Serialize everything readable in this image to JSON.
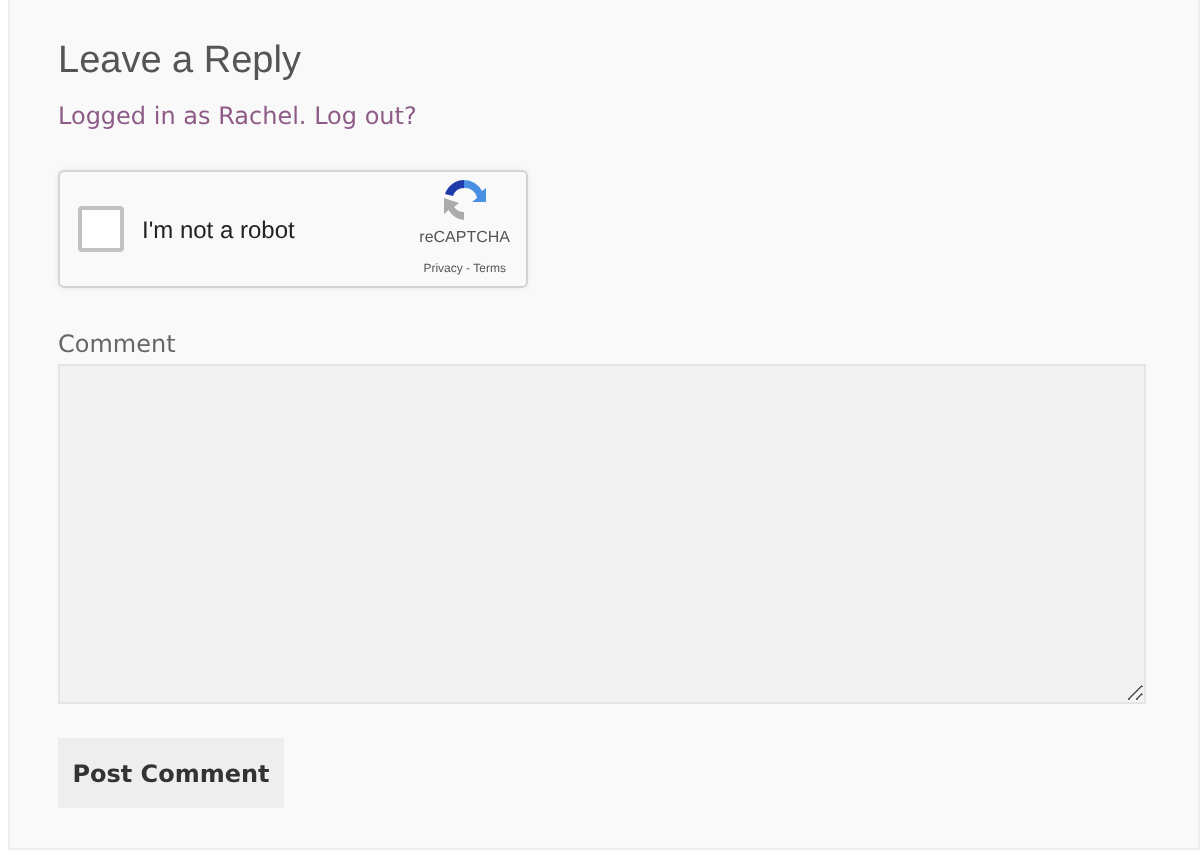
{
  "title": "Leave a Reply",
  "logged_in": {
    "text_before": "Logged in as",
    "user_link": "Rachel",
    "text_after": ".",
    "logout_link": "Log out?"
  },
  "captcha": {
    "label": "I'm not a robot",
    "checked": false,
    "brand": "reCAPTCHA",
    "privacy": "Privacy",
    "separator": "-",
    "terms": "Terms"
  },
  "comment": {
    "label": "Comment"
  },
  "submit": "Post Comment"
}
